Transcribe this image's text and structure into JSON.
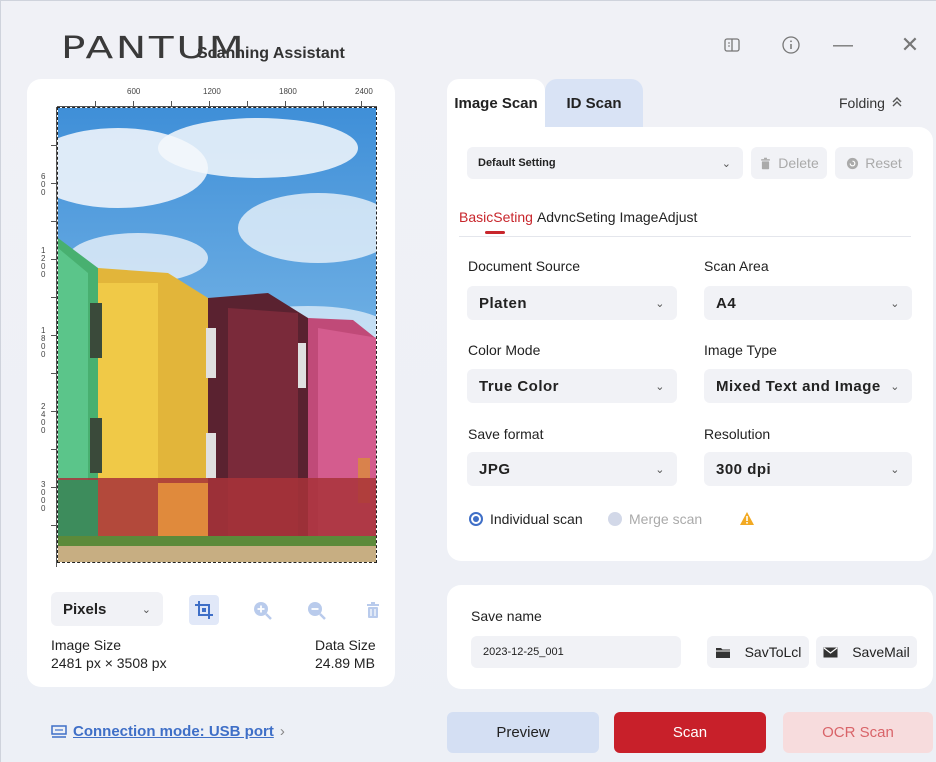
{
  "header": {
    "logo_text": "PANTUM",
    "subtitle": "Scanning Assistant"
  },
  "window_controls": {
    "book_icon": "book-icon",
    "info_icon": "info-icon",
    "minimize": "—",
    "close": "✕"
  },
  "preview": {
    "ruler_top_labels": [
      "600",
      "1200",
      "1800",
      "2400"
    ],
    "ruler_left_labels": [
      "600",
      "1200",
      "1800",
      "2400",
      "3000"
    ],
    "unit_select": "Pixels",
    "image_size_label": "Image Size",
    "image_size_value": "2481 px × 3508 px",
    "data_size_label": "Data Size",
    "data_size_value": "24.89 MB"
  },
  "connection": {
    "label": "Connection mode: USB port",
    "arrow": "›"
  },
  "tabs": {
    "image_scan": "Image Scan",
    "id_scan": "ID Scan",
    "folding": "Folding"
  },
  "settings": {
    "preset": "Default Setting",
    "delete": "Delete",
    "reset": "Reset",
    "subtabs": [
      "BasicSeting",
      "AdvncSeting",
      "ImageAdjust"
    ],
    "document_source_label": "Document Source",
    "document_source": "Platen",
    "scan_area_label": "Scan Area",
    "scan_area": "A4",
    "color_mode_label": "Color Mode",
    "color_mode": "True Color",
    "image_type_label": "Image Type",
    "image_type": "Mixed Text and Image",
    "save_format_label": "Save format",
    "save_format": "JPG",
    "resolution_label": "Resolution",
    "resolution": "300 dpi",
    "individual_scan": "Individual scan",
    "merge_scan": "Merge scan"
  },
  "save": {
    "label": "Save name",
    "value": "2023-12-25_001",
    "save_local": "SavToLcl",
    "save_mail": "SaveMail"
  },
  "actions": {
    "preview": "Preview",
    "scan": "Scan",
    "ocr_scan": "OCR Scan"
  },
  "colors": {
    "accent_red": "#c8202a",
    "accent_blue": "#3f6fc7",
    "panel_bg": "#ffffff"
  }
}
